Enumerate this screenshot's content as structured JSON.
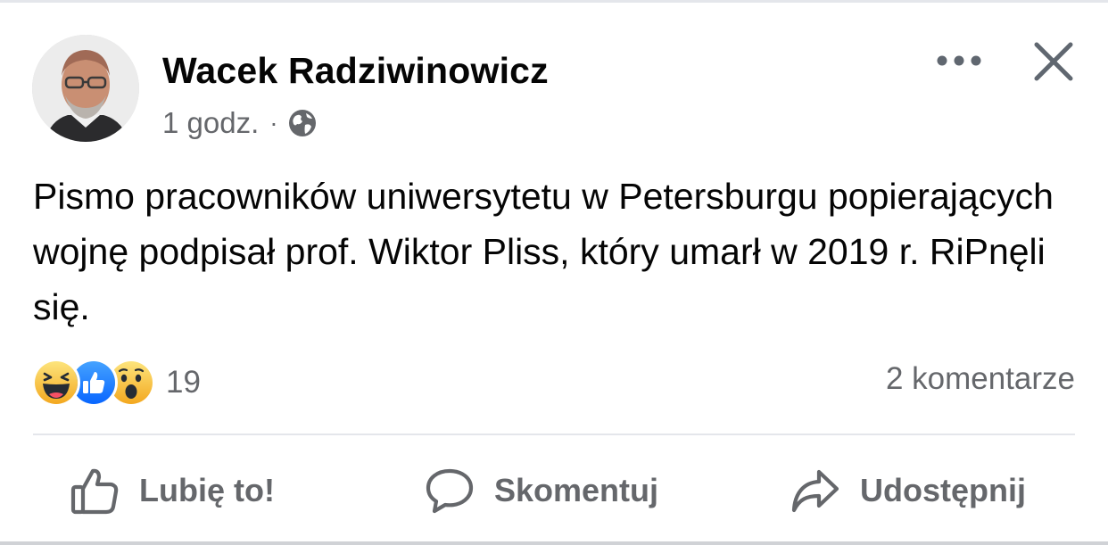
{
  "post": {
    "author": "Wacek Radziwinowicz",
    "time": "1 godz.",
    "separator": "·",
    "privacy_icon": "globe-icon",
    "text": "Pismo pracowników uniwersytetu w Petersburgu popierających wojnę podpisał prof. Wiktor Pliss, który umarł w 2019 r. RiPnęli się."
  },
  "header_actions": {
    "more_icon": "more-horizontal-icon",
    "close_icon": "close-icon"
  },
  "reactions": {
    "icons": [
      "haha-reaction-icon",
      "like-reaction-icon",
      "wow-reaction-icon"
    ],
    "count": "19"
  },
  "comments": {
    "count_label": "2 komentarze"
  },
  "actions": {
    "like_label": "Lubię to!",
    "comment_label": "Skomentuj",
    "share_label": "Udostępnij"
  },
  "colors": {
    "text_primary": "#050505",
    "text_secondary": "#65676b",
    "like_blue": "#1877f2",
    "reaction_yellow": "#f7b928",
    "divider": "#e4e6eb"
  }
}
